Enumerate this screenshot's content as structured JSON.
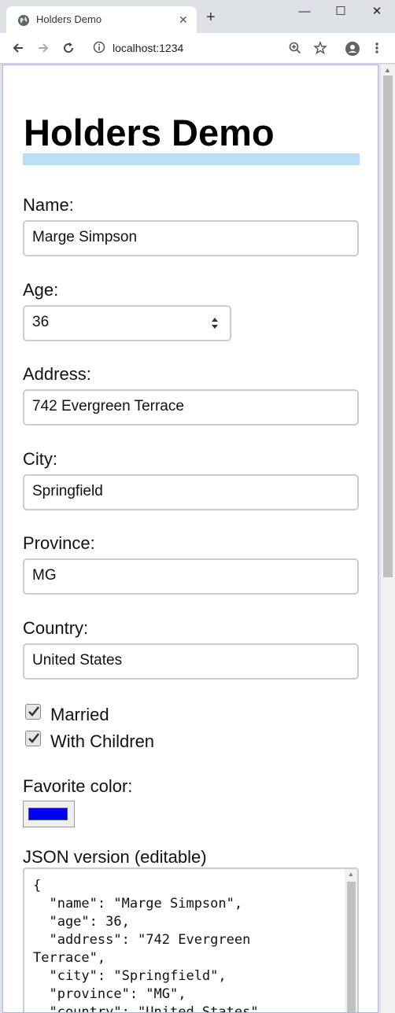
{
  "browser": {
    "tab_title": "Holders Demo",
    "tab_close": "✕",
    "new_tab": "+",
    "url": "localhost:1234",
    "minimize": "—",
    "maximize": "☐",
    "close": "✕"
  },
  "page": {
    "title": "Holders Demo",
    "fields": {
      "name": {
        "label": "Name:",
        "value": "Marge Simpson"
      },
      "age": {
        "label": "Age:",
        "value": "36"
      },
      "address": {
        "label": "Address:",
        "value": "742 Evergreen Terrace"
      },
      "city": {
        "label": "City:",
        "value": "Springfield"
      },
      "province": {
        "label": "Province:",
        "value": "MG"
      },
      "country": {
        "label": "Country:",
        "value": "United States"
      }
    },
    "married": {
      "label": "Married",
      "checked": true
    },
    "children": {
      "label": "With Children",
      "checked": true
    },
    "favorite_color": {
      "label": "Favorite color:",
      "value": "#0000ff"
    },
    "json": {
      "label": "JSON version (editable)",
      "text": "{\n  \"name\": \"Marge Simpson\",\n  \"age\": 36,\n  \"address\": \"742 Evergreen\nTerrace\",\n  \"city\": \"Springfield\",\n  \"province\": \"MG\",\n  \"country\": \"United States\","
    }
  }
}
